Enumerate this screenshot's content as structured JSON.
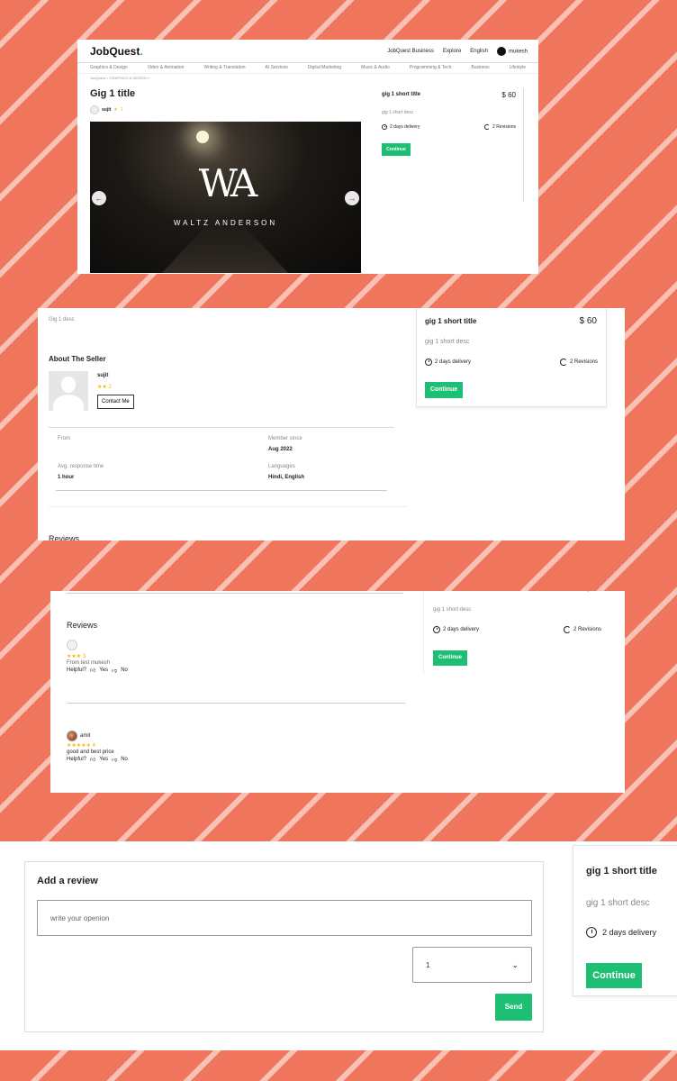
{
  "header": {
    "logo": "JobQuest",
    "logo_dot": ".",
    "nav": [
      "JobQuest Business",
      "Explore",
      "English"
    ],
    "user": "mukesh"
  },
  "categories": [
    "Graphics & Design",
    "Video & Animation",
    "Writing & Translation",
    "AI Services",
    "Digital Marketing",
    "Music & Audio",
    "Programming & Tech",
    "Business",
    "Lifestyle"
  ],
  "breadcrumb": "JobQuest > GRAPHICS & DESIGN >",
  "gig": {
    "title": "Gig 1 title",
    "seller_name": "sujit",
    "seller_rating": "1",
    "slide_brand": "WALTZ ANDERSON",
    "slide_monogram": "WA",
    "desc": "Gig 1 desc"
  },
  "order_card": {
    "title": "gig 1 short title",
    "price": "$ 60",
    "desc": "gig 1 short desc",
    "delivery": "2 days delivery",
    "revisions": "2 Revisions",
    "continue": "Continue"
  },
  "about_seller": {
    "heading": "About The Seller",
    "name": "sujit",
    "stars": "★★",
    "rating": "2",
    "contact_btn": "Contact Me",
    "from_label": "From",
    "from_value": "",
    "member_label": "Member since",
    "member_value": "Aug 2022",
    "response_label": "Avg. response time",
    "response_value": "1 hour",
    "languages_label": "Languages",
    "languages_value": "Hindi, English"
  },
  "reviews": {
    "title": "Reviews",
    "items": [
      {
        "user": "",
        "stars": "★★★",
        "rating": "3",
        "text": "From test mukesh",
        "helpful": "Helpful?",
        "yes": "Yes",
        "no": "No"
      },
      {
        "user": "amit",
        "stars": "★★★★★",
        "rating": "4",
        "text": "good and best price",
        "helpful": "Helpful?",
        "yes": "Yes",
        "no": "No"
      }
    ]
  },
  "add_review": {
    "title": "Add a review",
    "placeholder": "write your openion",
    "rating_selected": "1",
    "send": "Send"
  },
  "colors": {
    "background": "#ef765c",
    "accent": "#1dbf73",
    "star": "#f5b800"
  }
}
